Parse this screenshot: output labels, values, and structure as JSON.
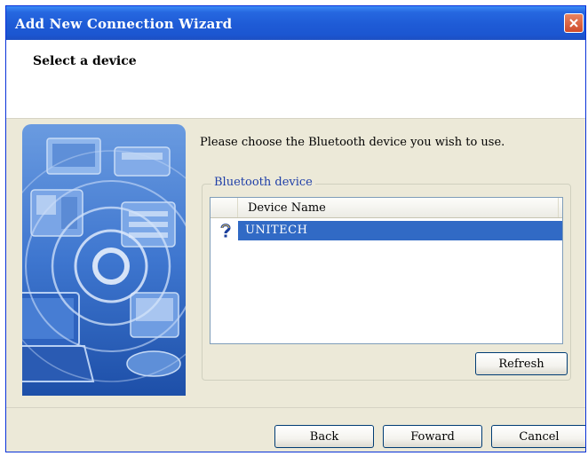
{
  "window": {
    "title": "Add New Connection Wizard"
  },
  "header": {
    "title": "Select a device"
  },
  "main": {
    "instruction": "Please choose the Bluetooth device you wish to use.",
    "group_label": "Bluetooth device",
    "list": {
      "columns": [
        "Device Name"
      ],
      "rows": [
        {
          "name": "UNITECH",
          "icon": "bluetooth-unknown-device-icon",
          "selected": true
        }
      ]
    },
    "refresh_label": "Refresh"
  },
  "footer": {
    "back_label": "Back",
    "forward_label": "Foward",
    "cancel_label": "Cancel"
  },
  "colors": {
    "titlebar": "#1e5bd6",
    "selection": "#316ac5",
    "dialog_bg": "#ece9d8",
    "group_label": "#1f3fa8"
  }
}
